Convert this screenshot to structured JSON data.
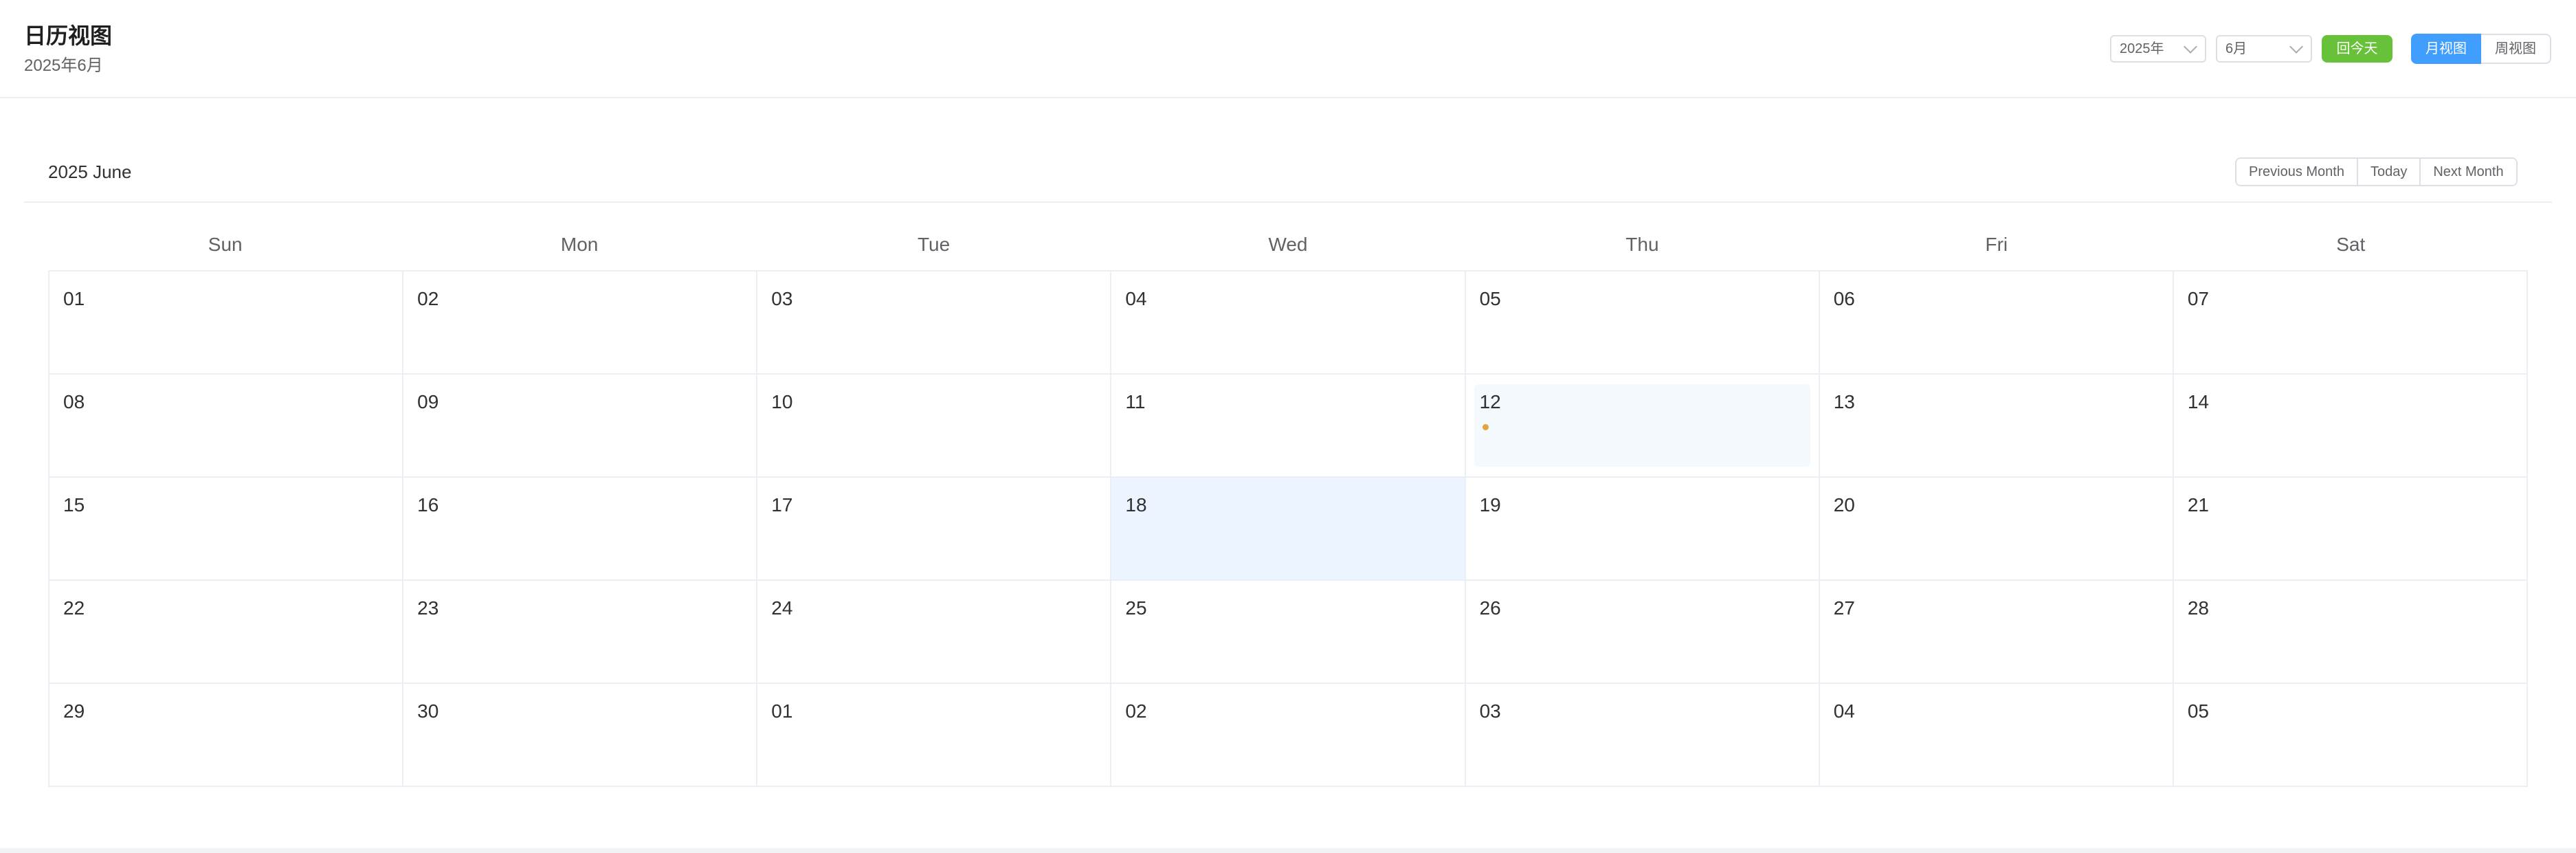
{
  "header": {
    "title": "日历视图",
    "subtitle": "2025年6月",
    "year_select": "2025年",
    "month_select": "6月",
    "today_button": "回今天",
    "month_view": "月视图",
    "week_view": "周视图"
  },
  "calendar": {
    "title": "2025 June",
    "nav": {
      "prev": "Previous Month",
      "today": "Today",
      "next": "Next Month"
    },
    "weekdays": [
      "Sun",
      "Mon",
      "Tue",
      "Wed",
      "Thu",
      "Fri",
      "Sat"
    ],
    "weeks": [
      [
        "01",
        "02",
        "03",
        "04",
        "05",
        "06",
        "07"
      ],
      [
        "08",
        "09",
        "10",
        "11",
        "12",
        "13",
        "14"
      ],
      [
        "15",
        "16",
        "17",
        "18",
        "19",
        "20",
        "21"
      ],
      [
        "22",
        "23",
        "24",
        "25",
        "26",
        "27",
        "28"
      ],
      [
        "29",
        "30",
        "01",
        "02",
        "03",
        "04",
        "05"
      ]
    ],
    "today_date": "12",
    "selected_date": "18",
    "event_dot_color": "#e6a23c"
  },
  "colors": {
    "primary": "#409eff",
    "success": "#67c23a",
    "selected_bg": "#ecf5ff",
    "today_bg": "#f4f9fe"
  }
}
